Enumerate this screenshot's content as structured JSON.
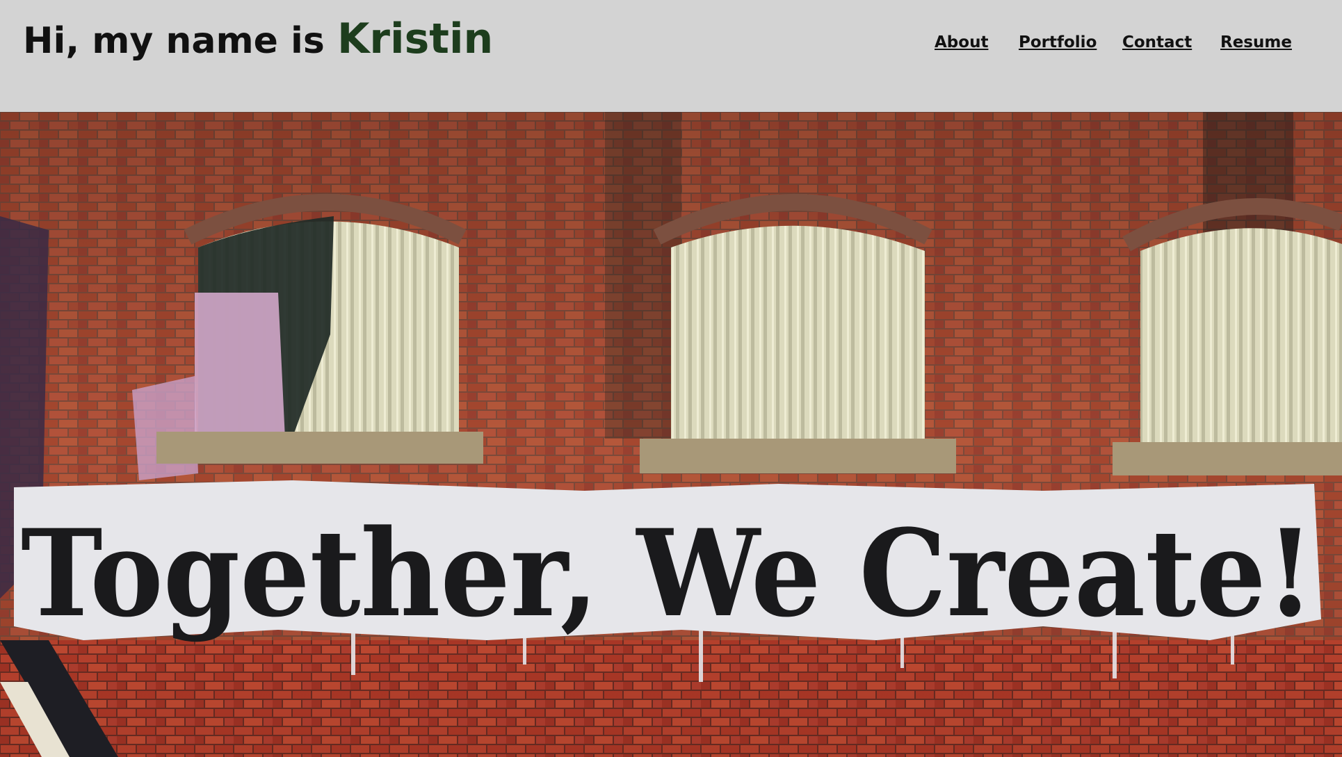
{
  "header": {
    "greeting": "Hi, my name is",
    "name": "Kristin"
  },
  "nav": {
    "items": [
      {
        "label": "About"
      },
      {
        "label": "Portfolio"
      },
      {
        "label": "Contact"
      },
      {
        "label": "Resume"
      }
    ]
  },
  "hero": {
    "mural_text": "Together, We Create!"
  },
  "colors": {
    "header_bg": "#d3d3d3",
    "name_accent": "#1d3d1d",
    "brick": "#a0452e",
    "shutter": "#d8d6b8"
  }
}
